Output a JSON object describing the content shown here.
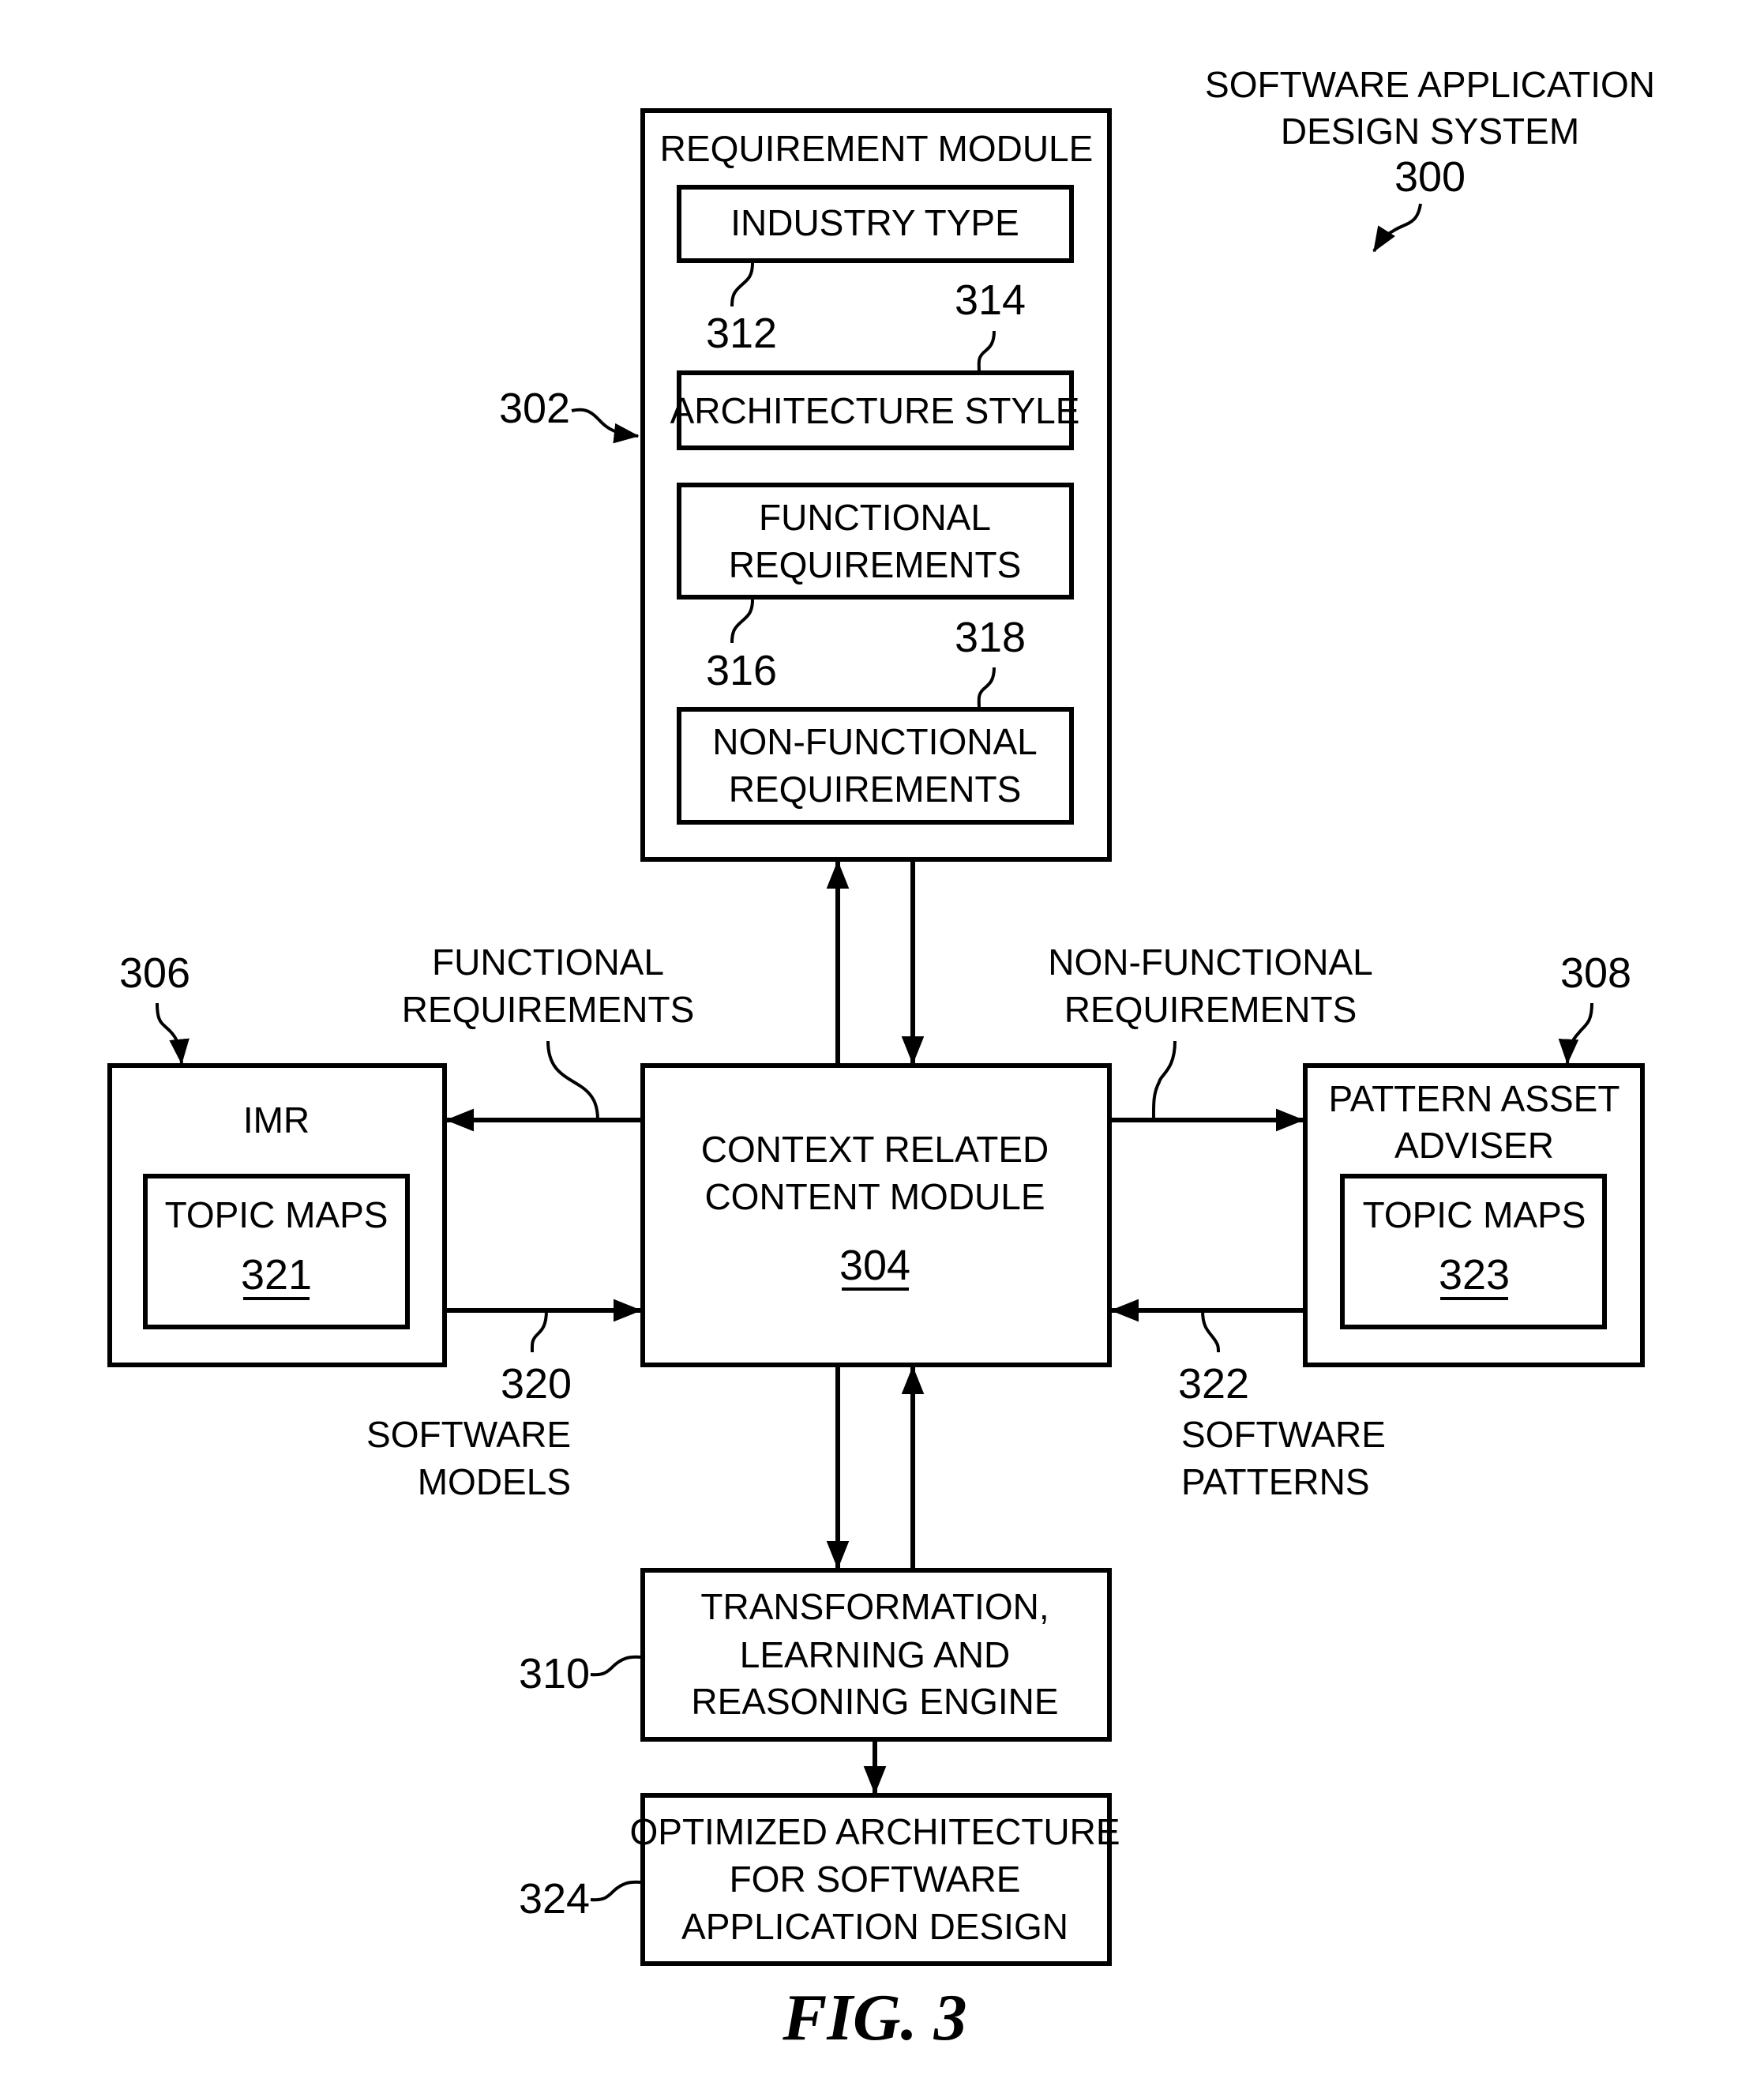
{
  "title": {
    "line1": "SOFTWARE APPLICATION",
    "line2": "DESIGN SYSTEM",
    "ref": "300"
  },
  "requirement_module": {
    "ref": "302",
    "title": "REQUIREMENT MODULE",
    "industry_type": {
      "label": "INDUSTRY TYPE",
      "ref": "312"
    },
    "architecture_style": {
      "label": "ARCHITECTURE STYLE",
      "ref": "314"
    },
    "functional_requirements": {
      "line1": "FUNCTIONAL",
      "line2": "REQUIREMENTS",
      "ref": "316"
    },
    "non_functional_requirements": {
      "line1": "NON-FUNCTIONAL",
      "line2": "REQUIREMENTS",
      "ref": "318"
    }
  },
  "context_module": {
    "line1": "CONTEXT RELATED",
    "line2": "CONTENT MODULE",
    "ref": "304"
  },
  "imr": {
    "ref": "306",
    "title": "IMR",
    "topic_maps": {
      "label": "TOPIC MAPS",
      "ref": "321"
    }
  },
  "pattern_asset_adviser": {
    "ref": "308",
    "line1": "PATTERN ASSET",
    "line2": "ADVISER",
    "topic_maps": {
      "label": "TOPIC MAPS",
      "ref": "323"
    }
  },
  "connectors": {
    "functional_requirements": {
      "line1": "FUNCTIONAL",
      "line2": "REQUIREMENTS"
    },
    "non_functional_requirements": {
      "line1": "NON-FUNCTIONAL",
      "line2": "REQUIREMENTS"
    },
    "software_models": {
      "ref": "320",
      "line1": "SOFTWARE",
      "line2": "MODELS"
    },
    "software_patterns": {
      "ref": "322",
      "line1": "SOFTWARE",
      "line2": "PATTERNS"
    }
  },
  "engine": {
    "ref": "310",
    "line1": "TRANSFORMATION,",
    "line2": "LEARNING AND",
    "line3": "REASONING ENGINE"
  },
  "output": {
    "ref": "324",
    "line1": "OPTIMIZED ARCHITECTURE",
    "line2": "FOR SOFTWARE",
    "line3": "APPLICATION DESIGN"
  },
  "figure_label": "FIG. 3"
}
